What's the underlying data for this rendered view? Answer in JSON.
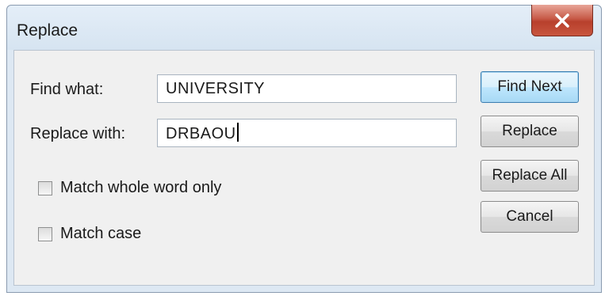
{
  "window": {
    "title": "Replace"
  },
  "find": {
    "label": "Find what:",
    "value": "UNIVERSITY"
  },
  "replace": {
    "label": "Replace with:",
    "value": "DRBAOU"
  },
  "options": {
    "match_whole_word": {
      "label": "Match whole word only",
      "checked": false
    },
    "match_case": {
      "label": "Match case",
      "checked": false
    }
  },
  "buttons": {
    "find_next": "Find Next",
    "replace": "Replace",
    "replace_all": "Replace All",
    "cancel": "Cancel"
  },
  "icons": {
    "close": "close-icon"
  },
  "colors": {
    "dialog_bg": "#f0f0f0",
    "title_bg": "#dde8f3",
    "close_button": "#c75a47",
    "default_button_border": "#3c7fb1"
  }
}
